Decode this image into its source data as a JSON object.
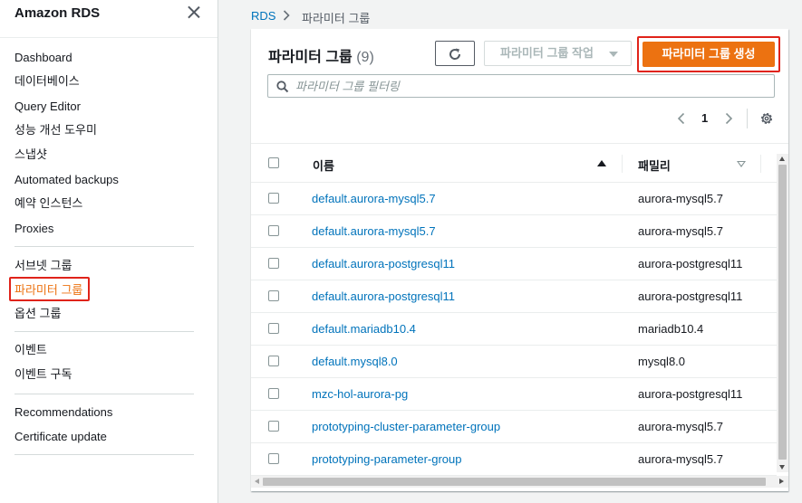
{
  "sidebar": {
    "title": "Amazon RDS",
    "groups": [
      [
        {
          "label": "Dashboard"
        },
        {
          "label": "데이터베이스"
        },
        {
          "label": "Query Editor"
        },
        {
          "label": "성능 개선 도우미"
        },
        {
          "label": "스냅샷"
        },
        {
          "label": "Automated backups"
        },
        {
          "label": "예약 인스턴스"
        },
        {
          "label": "Proxies"
        }
      ],
      [
        {
          "label": "서브넷 그룹"
        },
        {
          "label": "파라미터 그룹",
          "active": true
        },
        {
          "label": "옵션 그룹"
        }
      ],
      [
        {
          "label": "이벤트"
        },
        {
          "label": "이벤트 구독"
        }
      ],
      [
        {
          "label": "Recommendations"
        },
        {
          "label": "Certificate update"
        }
      ]
    ]
  },
  "breadcrumb": {
    "root": "RDS",
    "current": "파라미터 그룹"
  },
  "panel": {
    "title": "파라미터 그룹",
    "count": "(9)",
    "actions_label": "파라미터 그룹 작업",
    "create_label": "파라미터 그룹 생성",
    "filter_placeholder": "파라미터 그룹 필터링",
    "page": "1"
  },
  "table": {
    "columns": [
      "이름",
      "패밀리"
    ],
    "rows": [
      {
        "name": "default.aurora-mysql5.7",
        "family": "aurora-mysql5.7"
      },
      {
        "name": "default.aurora-mysql5.7",
        "family": "aurora-mysql5.7"
      },
      {
        "name": "default.aurora-postgresql11",
        "family": "aurora-postgresql11"
      },
      {
        "name": "default.aurora-postgresql11",
        "family": "aurora-postgresql11"
      },
      {
        "name": "default.mariadb10.4",
        "family": "mariadb10.4"
      },
      {
        "name": "default.mysql8.0",
        "family": "mysql8.0"
      },
      {
        "name": "mzc-hol-aurora-pg",
        "family": "aurora-postgresql11"
      },
      {
        "name": "prototyping-cluster-parameter-group",
        "family": "aurora-mysql5.7"
      },
      {
        "name": "prototyping-parameter-group",
        "family": "aurora-mysql5.7"
      }
    ]
  },
  "icons": {
    "close": "close-icon",
    "refresh": "refresh-icon",
    "search": "search-icon",
    "settings": "gear-icon"
  },
  "colors": {
    "accent": "#ec7211",
    "link": "#0073bb",
    "highlight_box": "#e0231a"
  }
}
